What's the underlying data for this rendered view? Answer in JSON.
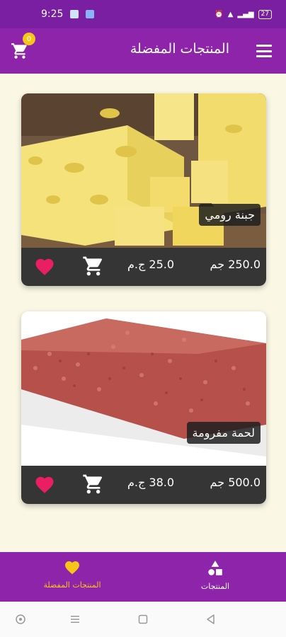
{
  "status_bar": {
    "time": "9:25",
    "battery": "27",
    "icons": [
      "gallery-icon",
      "bluetooth-icon",
      "alarm-icon",
      "wifi-icon",
      "signal-icon",
      "battery-icon"
    ]
  },
  "app_bar": {
    "title": "المنتجات المفضلة",
    "cart_count": "0",
    "icons": {
      "cart": "cart-icon",
      "menu": "menu-icon"
    }
  },
  "products": [
    {
      "name": "جبنة رومي",
      "price_value": "25.0",
      "price_unit": "ج.م",
      "weight_value": "250.0",
      "weight_unit": "جم",
      "image": "cheese-image"
    },
    {
      "name": "لحمة مفرومة",
      "price_value": "38.0",
      "price_unit": "ج.م",
      "weight_value": "500.0",
      "weight_unit": "جم",
      "image": "minced-meat-image"
    }
  ],
  "bottom_nav": {
    "items": [
      {
        "label": "المنتجات المفضلة",
        "icon": "heart-icon",
        "active": true
      },
      {
        "label": "المنتجات",
        "icon": "shapes-icon",
        "active": false
      }
    ]
  },
  "colors": {
    "primary": "#8e24aa",
    "status_bar": "#7b1fa2",
    "accent": "#f5c518",
    "background": "#faf8e4",
    "card_bar": "#353535",
    "favorite": "#e91e63"
  }
}
